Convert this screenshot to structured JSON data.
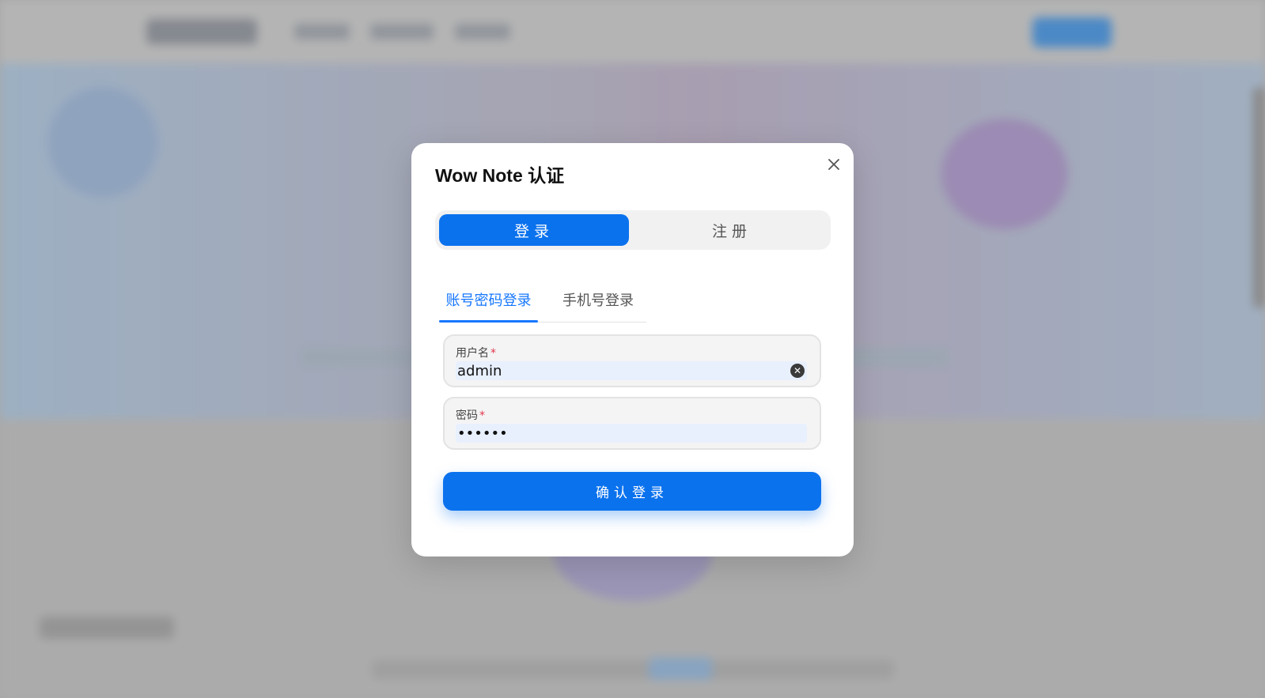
{
  "modal": {
    "title": "Wow Note 认证",
    "close_icon": "close-icon",
    "segments": {
      "login": "登录",
      "register": "注册",
      "active": "login"
    },
    "tabs": [
      {
        "label": "账号密码登录",
        "active": true
      },
      {
        "label": "手机号登录",
        "active": false
      }
    ],
    "username": {
      "label": "用户名",
      "required_mark": "*",
      "value": "admin"
    },
    "password": {
      "label": "密码",
      "required_mark": "*",
      "value": "••••••"
    },
    "submit_label": "确认登录"
  },
  "colors": {
    "primary": "#0b72ee",
    "tab_active": "#1677ff",
    "required": "#e3344b"
  }
}
